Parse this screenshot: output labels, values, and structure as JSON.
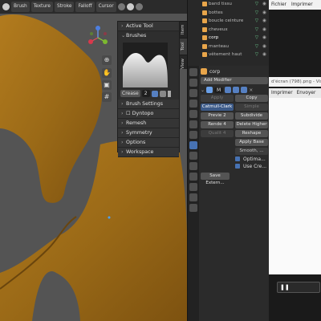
{
  "toolbar": {
    "items": [
      "Brush",
      "Texture",
      "Stroke",
      "Falloff",
      "Cursor"
    ]
  },
  "npanel": {
    "active_tool": "Active Tool",
    "brushes": "Brushes",
    "crease_label": "Crease",
    "crease_value": "2",
    "brush_settings": "Brush Settings",
    "dyntopo": "Dyntopo",
    "remesh": "Remesh",
    "symmetry": "Symmetry",
    "options": "Options",
    "workspace": "Workspace"
  },
  "vtabs": [
    "Item",
    "Tool",
    "View"
  ],
  "outliner": {
    "rows": [
      "band tissu",
      "bottes",
      "boucle ceinture",
      "cheveux",
      "corp",
      "manteau",
      "vêtement haut"
    ],
    "selected": "corp"
  },
  "properties": {
    "object_name": "corp",
    "add_modifier": "Add Modifier",
    "modifier_short": "M",
    "apply": "Apply",
    "copy": "Copy",
    "catmull_clark": "Catmull-Clark",
    "simple": "Simple",
    "preview_label": "Previe",
    "preview_value": "2",
    "subdivide": "Subdivide",
    "render_label": "Rende",
    "render_value": "4",
    "delete_higher": "Delete Higher",
    "quality_label": "Qualit",
    "quality_value": "4",
    "reshape": "Reshape",
    "apply_base": "Apply Base",
    "smooth": "Smooth, ...",
    "optimal": "Optima...",
    "use_crease": "Use Cre...",
    "save_external": "Save Extern..."
  },
  "right_app": {
    "menu": [
      "Fichier",
      "Imprimer"
    ],
    "title": "d'écran (798).png - Visio",
    "menu2": [
      "Imprimer",
      "Envoyer"
    ]
  },
  "colors": {
    "skin": "#a7731c",
    "accent": "#4772b3"
  }
}
